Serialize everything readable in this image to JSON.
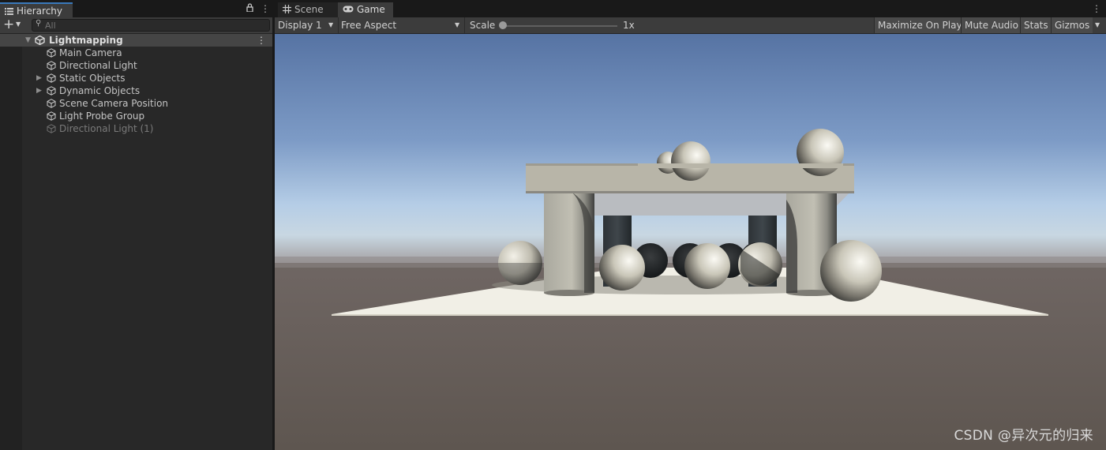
{
  "hierarchy": {
    "tab_label": "Hierarchy",
    "search_placeholder": "All",
    "scene": {
      "name": "Lightmapping"
    },
    "items": [
      {
        "label": "Main Camera",
        "expandable": false,
        "active": true
      },
      {
        "label": "Directional Light",
        "expandable": false,
        "active": true
      },
      {
        "label": "Static Objects",
        "expandable": true,
        "active": true
      },
      {
        "label": "Dynamic Objects",
        "expandable": true,
        "active": true
      },
      {
        "label": "Scene Camera Position",
        "expandable": false,
        "active": true
      },
      {
        "label": "Light Probe Group",
        "expandable": false,
        "active": true
      },
      {
        "label": "Directional Light (1)",
        "expandable": false,
        "active": false
      }
    ]
  },
  "game_view": {
    "tabs": [
      {
        "label": "Scene",
        "icon": "grid-icon",
        "active": false
      },
      {
        "label": "Game",
        "icon": "gamepad-icon",
        "active": true
      }
    ],
    "toolbar": {
      "display": "Display 1",
      "aspect": "Free Aspect",
      "scale_label": "Scale",
      "scale_value": "1x",
      "maximize_on_play": "Maximize On Play",
      "mute_audio": "Mute Audio",
      "stats": "Stats",
      "gizmos": "Gizmos"
    }
  },
  "watermark": "CSDN @异次元的归来",
  "colors": {
    "panel_bg": "#282828",
    "toolbar_bg": "#3c3c3c",
    "selection_blue": "#3a79bb",
    "sky_top": "#5673a3",
    "ground": "#625a54"
  }
}
